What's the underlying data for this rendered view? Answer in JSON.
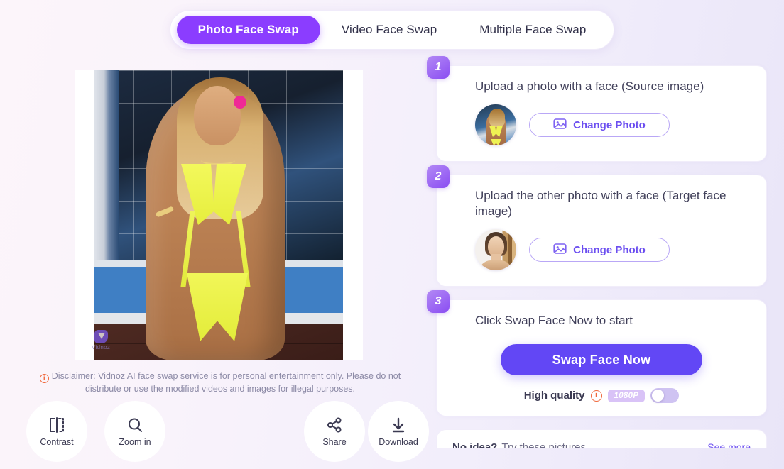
{
  "tabs": [
    {
      "label": "Photo Face Swap",
      "active": true
    },
    {
      "label": "Video Face Swap",
      "active": false
    },
    {
      "label": "Multiple Face Swap",
      "active": false
    }
  ],
  "preview": {
    "watermark_text": "Vidnoz",
    "watermark_icon": "vidnoz-logo-icon"
  },
  "disclaimer": {
    "icon": "info-icon",
    "text": "Disclaimer: Vidnoz AI face swap service is for personal entertainment only. Please do not distribute or use the modified videos and images for illegal purposes."
  },
  "tools": [
    {
      "label": "Contrast",
      "icon": "contrast-compare-icon"
    },
    {
      "label": "Zoom in",
      "icon": "magnifier-icon"
    },
    {
      "label": "Share",
      "icon": "share-nodes-icon"
    },
    {
      "label": "Download",
      "icon": "download-arrow-icon"
    }
  ],
  "steps": [
    {
      "number": "1",
      "title": "Upload a photo with a face (Source image)",
      "thumb_alt": "source-photo-thumbnail",
      "button_label": "Change Photo",
      "button_icon": "image-icon"
    },
    {
      "number": "2",
      "title": "Upload the other photo with a face (Target face image)",
      "thumb_alt": "target-face-thumbnail",
      "button_label": "Change Photo",
      "button_icon": "image-icon"
    },
    {
      "number": "3",
      "title": "Click Swap Face Now to start",
      "action_label": "Swap Face Now",
      "quality_label": "High quality",
      "quality_info_icon": "info-icon",
      "quality_badge": "1080P",
      "quality_toggle_state": "off"
    }
  ],
  "more_section": {
    "heading": "No idea?",
    "subheading": "Try these pictures",
    "see_more_label": "See more"
  },
  "colors": {
    "accent_tab": "#8b3dff",
    "accent_button": "#6247f5",
    "accent_outline": "#6b4ef0",
    "info_orange": "#f0693d",
    "badge_pill": "#d9c3f7"
  }
}
